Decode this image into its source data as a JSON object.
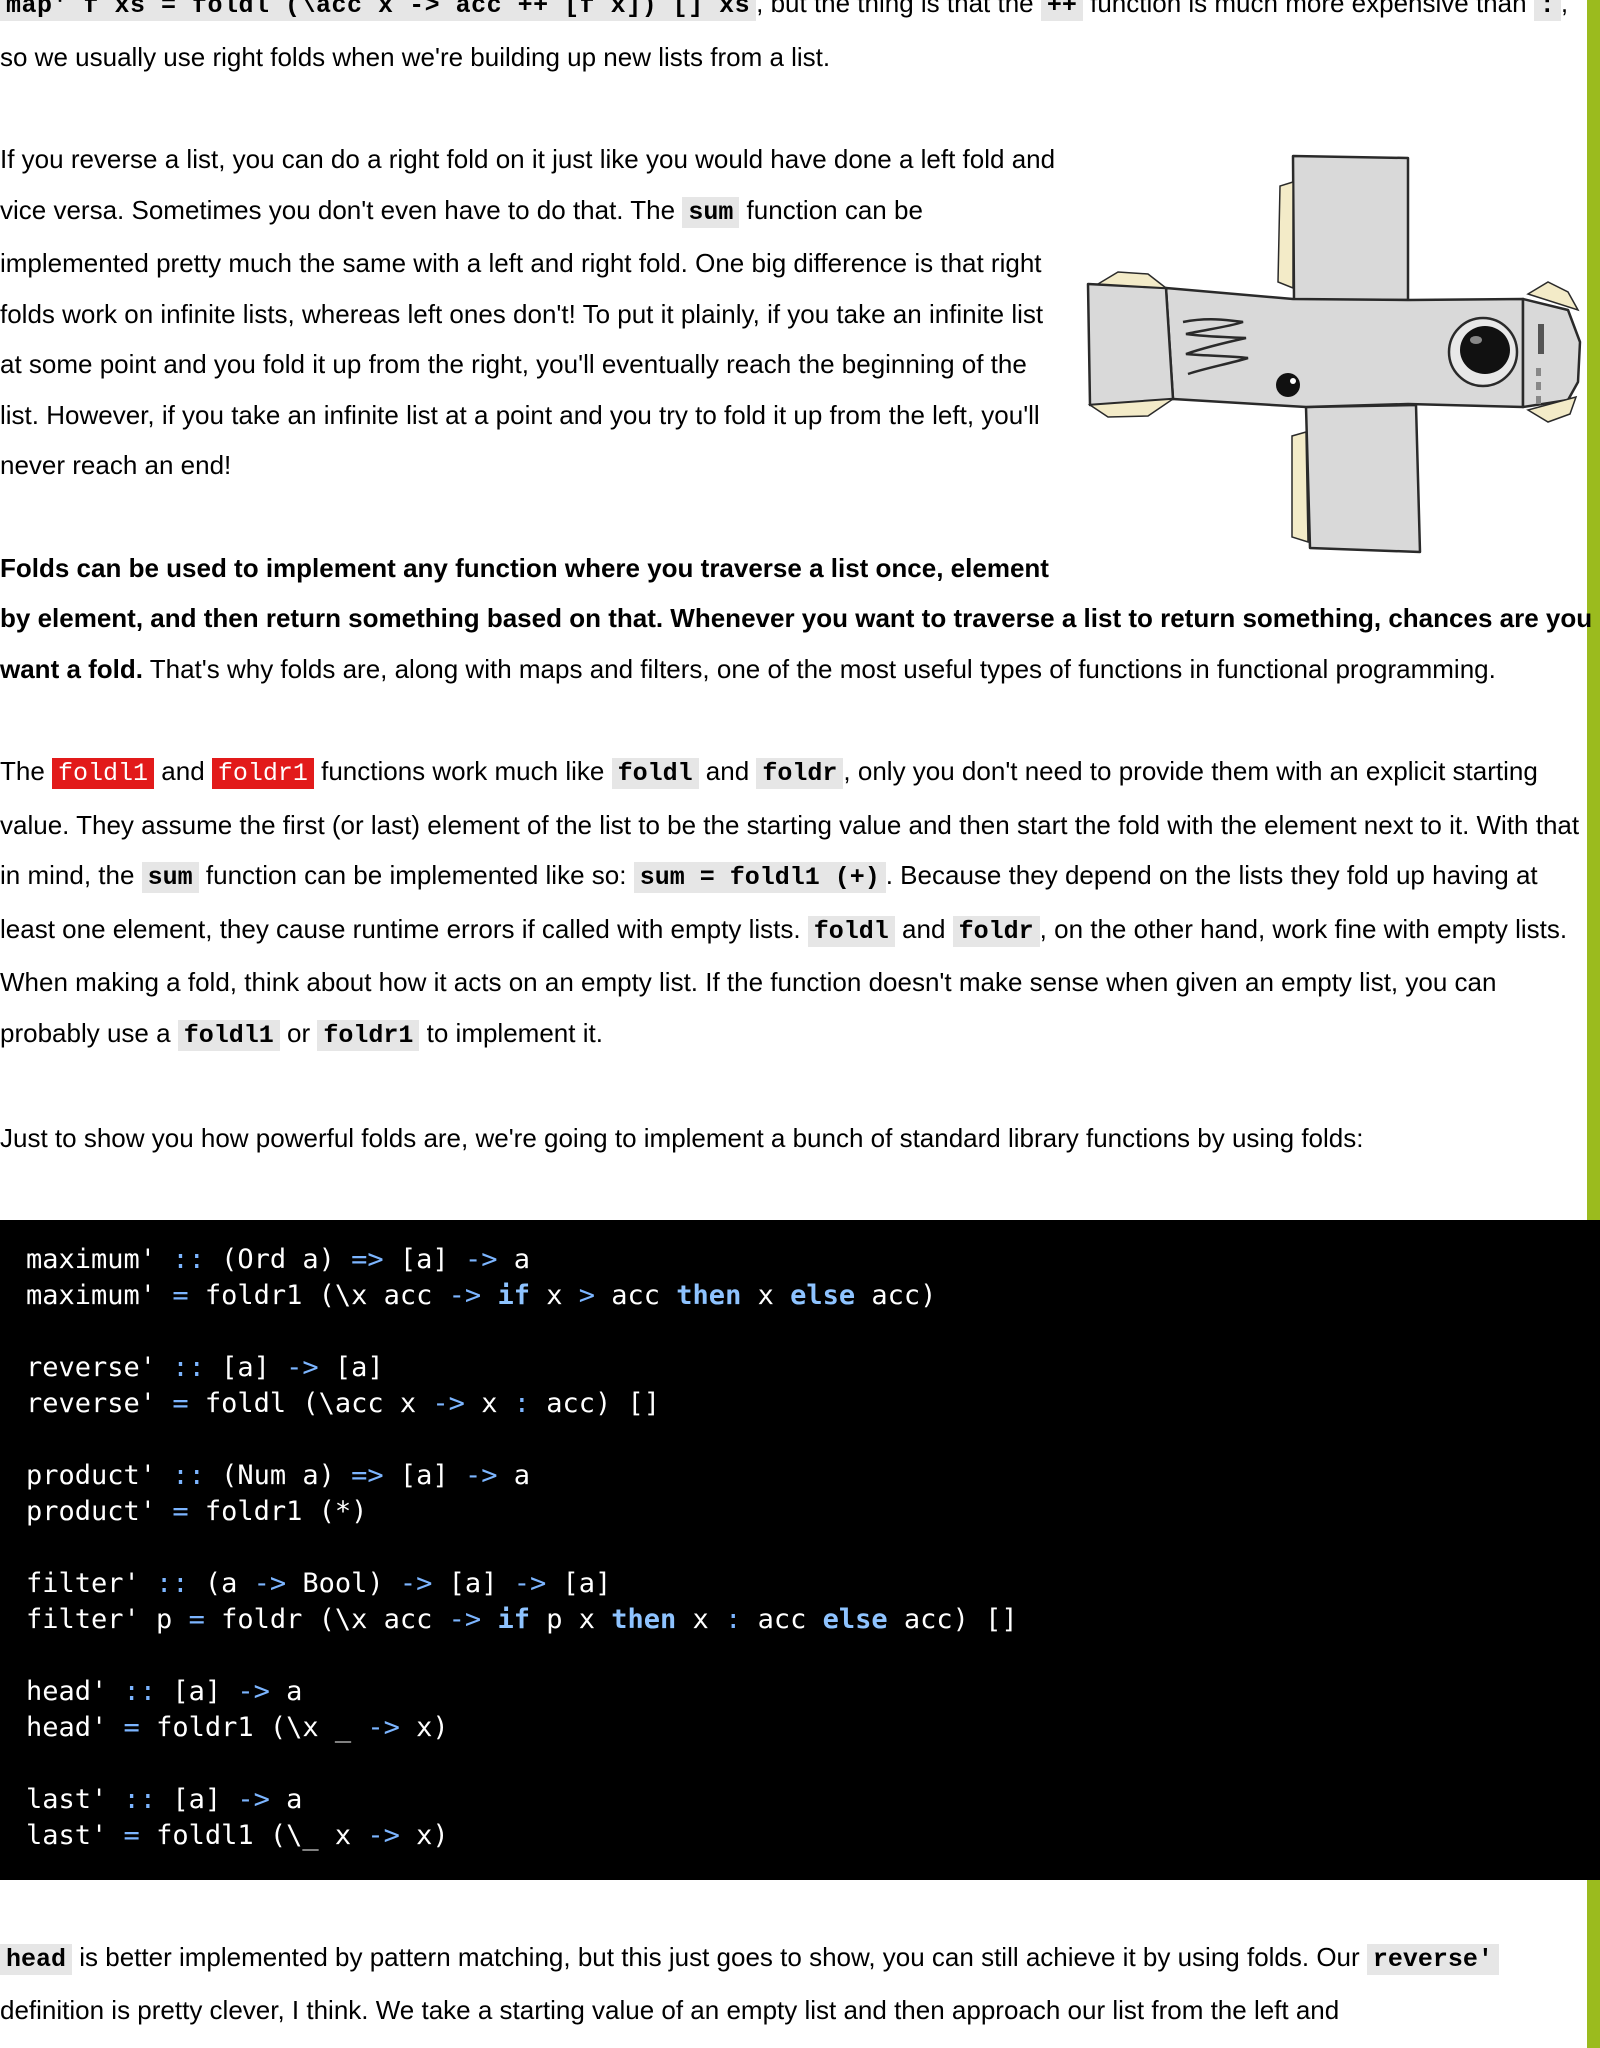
{
  "colors": {
    "accent_bar": "#9bbb1e",
    "highlight": "#e21a1a",
    "code_bg": "#000000",
    "inline_code_bg": "#e6e6e6"
  },
  "para0": {
    "c1": "map' f xs = foldl (\\acc x -> acc ++ [f x]) [] xs",
    "t1": ", but the thing is that the ",
    "c2": "++",
    "t2": " function is much more expensive than ",
    "c3": ":",
    "t3": ", so we usually use right folds when we're building up new lists from a list."
  },
  "para1": {
    "t1": "If you reverse a list, you can do a right fold on it just like you would have done a left fold and vice versa. Sometimes you don't even have to do that. The ",
    "c1": "sum",
    "t2": " function can be implemented pretty much the same with a left and right fold. One big difference is that right folds work on infinite lists, whereas left ones don't! To put it plainly, if you take an infinite list at some point and you fold it up from the right, you'll eventually reach the beginning of the list. However, if you take an infinite list at a point and you try to fold it up from the left, you'll never reach an end!"
  },
  "para2": {
    "bold": "Folds can be used to implement any function where you traverse a list once, element by element, and then return something based on that. Whenever you want to traverse a list to return something, chances are you want a fold.",
    "t1": " That's why folds are, along with maps and filters, one of the most useful types of functions in functional programming."
  },
  "para3": {
    "t0": "The ",
    "h1": "foldl1",
    "t1": " and ",
    "h2": "foldr1",
    "t2": " functions work much like ",
    "c1": "foldl",
    "t3": " and ",
    "c2": "foldr",
    "t4": ", only you don't need to provide them with an explicit starting value. They assume the first (or last) element of the list to be the starting value and then start the fold with the element next to it. With that in mind, the ",
    "c3": "sum",
    "t5": " function can be implemented like so: ",
    "c4": "sum = foldl1 (+)",
    "t6": ". Because they depend on the lists they fold up having at least one element, they cause runtime errors if called with empty lists. ",
    "c5": "foldl",
    "t7": " and ",
    "c6": "foldr",
    "t8": ", on the other hand, work fine with empty lists. When making a fold, think about how it acts on an empty list. If the function doesn't make sense when given an empty list, you can probably use a ",
    "c7": "foldl1",
    "t9": " or ",
    "c8": "foldr1",
    "t10": " to implement it."
  },
  "para4": "Just to show you how powerful folds are, we're going to implement a bunch of standard library functions by using folds:",
  "code": {
    "l1": [
      "maximum' ",
      "::",
      " (Ord a) ",
      "=>",
      " [a] ",
      "->",
      " a"
    ],
    "l2": [
      "maximum' ",
      "=",
      " foldr1 (\\x acc ",
      "->",
      " ",
      "if",
      " x ",
      ">",
      " acc ",
      "then",
      " x ",
      "else",
      " acc)"
    ],
    "l3": [
      "reverse' ",
      "::",
      " [a] ",
      "->",
      " [a]"
    ],
    "l4": [
      "reverse' ",
      "=",
      " foldl (\\acc x ",
      "->",
      " x ",
      ":",
      " acc) []"
    ],
    "l5": [
      "product' ",
      "::",
      " (Num a) ",
      "=>",
      " [a] ",
      "->",
      " a"
    ],
    "l6": [
      "product' ",
      "=",
      " foldr1 (*)"
    ],
    "l7": [
      "filter' ",
      "::",
      " (a ",
      "->",
      " Bool) ",
      "->",
      " [a] ",
      "->",
      " [a]"
    ],
    "l8": [
      "filter' p ",
      "=",
      " foldr (\\x acc ",
      "->",
      " ",
      "if",
      " p x ",
      "then",
      " x ",
      ":",
      " acc ",
      "else",
      " acc) []"
    ],
    "l9": [
      "head' ",
      "::",
      " [a] ",
      "->",
      " a"
    ],
    "l10": [
      "head' ",
      "=",
      " foldr1 (\\x _ ",
      "->",
      " x)"
    ],
    "l11": [
      "last' ",
      "::",
      " [a] ",
      "->",
      " a"
    ],
    "l12": [
      "last' ",
      "=",
      " foldl1 (\\_ x ",
      "->",
      " x)"
    ]
  },
  "para5": {
    "c1": "head",
    "t1": " is better implemented by pattern matching, but this just goes to show, you can still achieve it by using folds. Our ",
    "c2": "reverse'",
    "t2": " definition is pretty clever, I think. We take a starting value of an empty list and then approach our list from the left and"
  }
}
